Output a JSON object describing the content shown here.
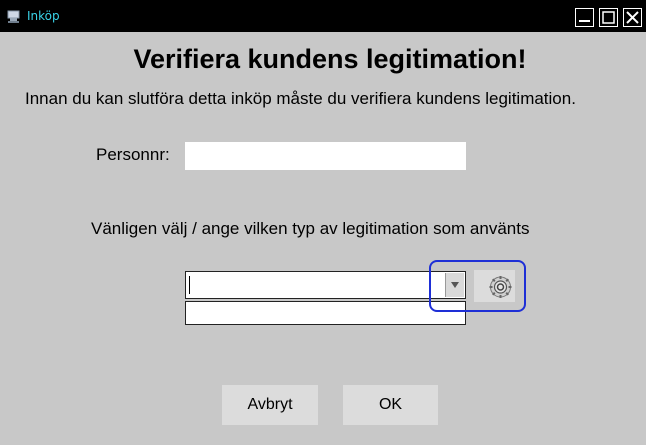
{
  "window": {
    "title": "Inköp",
    "icons": {
      "app": "app-icon",
      "minimize": "minimize-icon",
      "maximize": "maximize-icon",
      "close": "close-icon"
    }
  },
  "main": {
    "title": "Verifiera kundens legitimation!",
    "subtitle": "Innan du kan slutföra detta inköp måste du verifiera kundens legitimation.",
    "personnr": {
      "label": "Personnr:",
      "value": ""
    },
    "id_type": {
      "label": "Vänligen välj / ange vilken typ av legitimation som använts",
      "selected": "",
      "settings_icon": "gear-icon"
    }
  },
  "buttons": {
    "cancel": "Avbryt",
    "ok": "OK"
  },
  "colors": {
    "background": "#c8c8c8",
    "titlebar": "#000000",
    "title_text": "#39d3e8",
    "highlight": "#1e2fd6"
  }
}
